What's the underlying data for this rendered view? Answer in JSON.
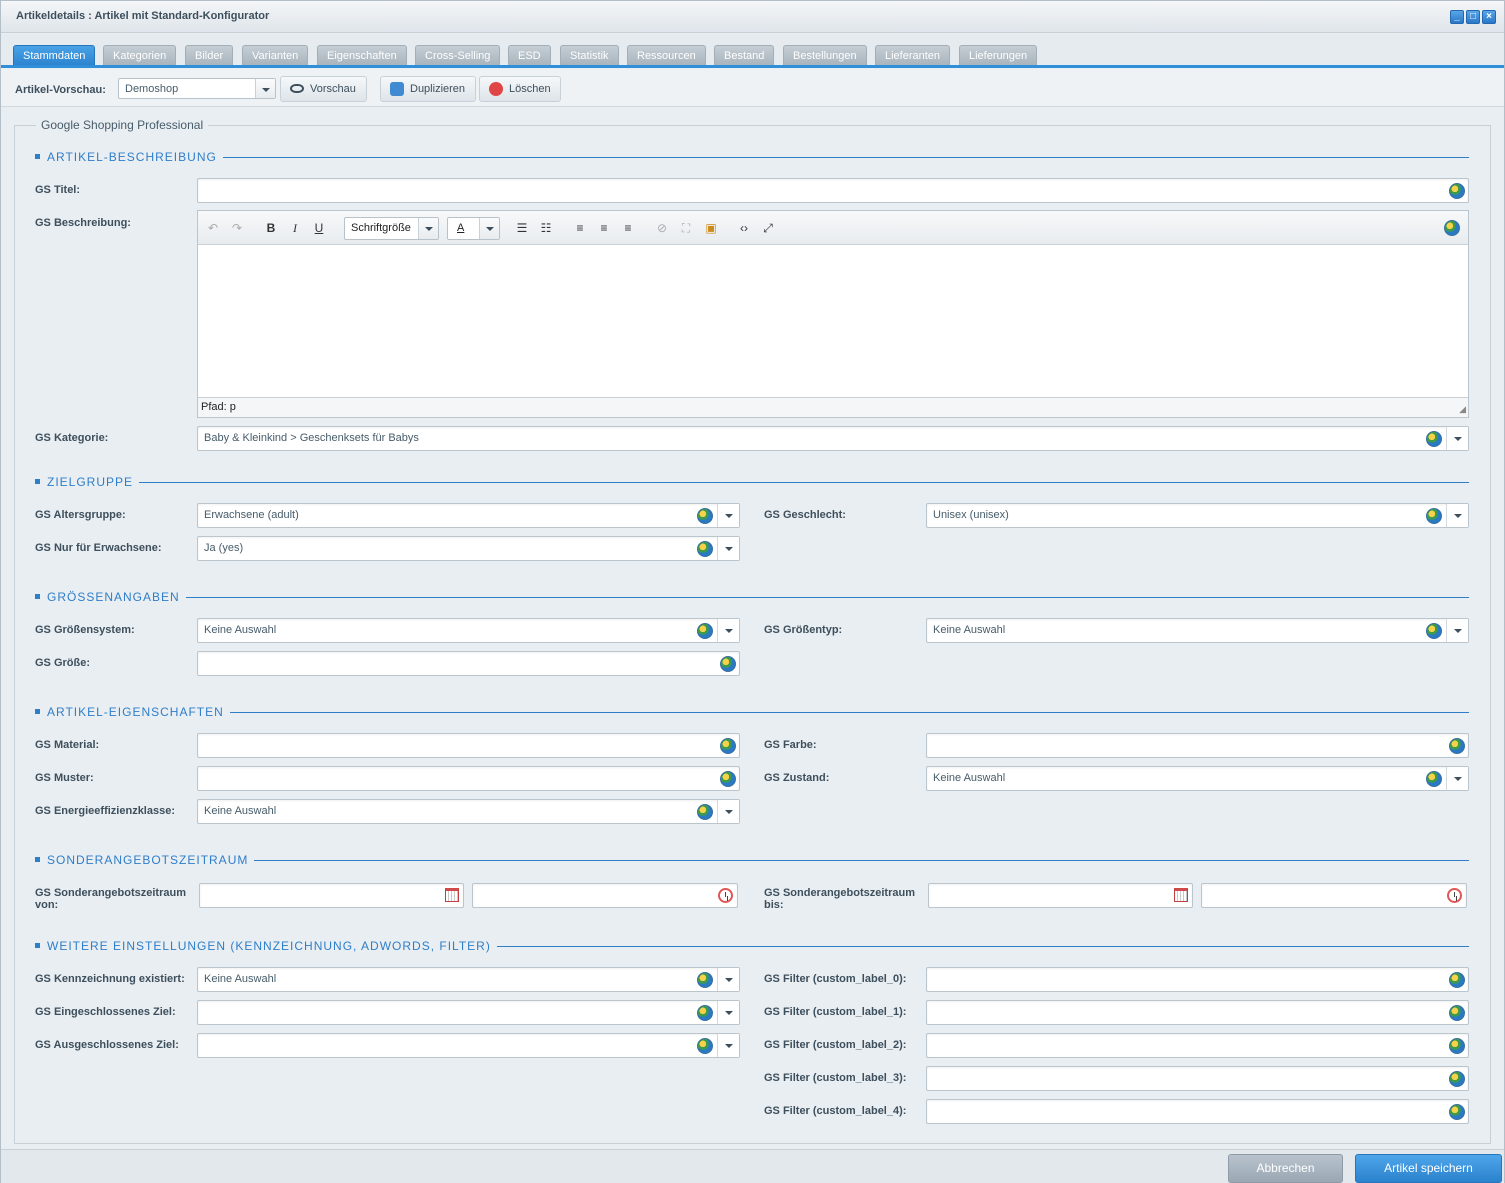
{
  "window": {
    "title": "Artikeldetails : Artikel mit Standard-Konfigurator"
  },
  "tabs": [
    "Stammdaten",
    "Kategorien",
    "Bilder",
    "Varianten",
    "Eigenschaften",
    "Cross-Selling",
    "ESD",
    "Statistik",
    "Ressourcen",
    "Bestand",
    "Bestellungen",
    "Lieferanten",
    "Lieferungen"
  ],
  "toolbar": {
    "preview_label": "Artikel-Vorschau:",
    "shop_value": "Demoshop",
    "vorschau": "Vorschau",
    "duplizieren": "Duplizieren",
    "loeschen": "Löschen"
  },
  "panel": {
    "legend": "Google Shopping Professional"
  },
  "sections": {
    "beschreibung": "ARTIKEL-BESCHREIBUNG",
    "zielgruppe": "ZIELGRUPPE",
    "groesse": "GRÖSSENANGABEN",
    "eigenschaften": "ARTIKEL-EIGENSCHAFTEN",
    "sonder": "SONDERANGEBOTSZEITRAUM",
    "weitere": "WEITERE EINSTELLUNGEN (KENNZEICHNUNG, ADWORDS, FILTER)"
  },
  "labels": {
    "titel": "GS Titel:",
    "beschreibung": "GS Beschreibung:",
    "kategorie": "GS Kategorie:",
    "altersgruppe": "GS Altersgruppe:",
    "geschlecht": "GS Geschlecht:",
    "nur_erwachsene": "GS Nur für Erwachsene:",
    "groessensystem": "GS Größensystem:",
    "groessentyp": "GS Größentyp:",
    "groesse": "GS Größe:",
    "material": "GS Material:",
    "farbe": "GS Farbe:",
    "muster": "GS Muster:",
    "zustand": "GS Zustand:",
    "energie": "GS Energieeffizienzklasse:",
    "sonder_von_1": "GS Sonderangebotszeitraum",
    "sonder_von_2": "von:",
    "sonder_bis_1": "GS Sonderangebotszeitraum",
    "sonder_bis_2": "bis:",
    "kennzeichnung": "GS Kennzeichnung existiert:",
    "eingeschlossen": "GS Eingeschlossenes Ziel:",
    "ausgeschlossen": "GS Ausgeschlossenes Ziel:",
    "filter0": "GS Filter (custom_label_0):",
    "filter1": "GS Filter (custom_label_1):",
    "filter2": "GS Filter (custom_label_2):",
    "filter3": "GS Filter (custom_label_3):",
    "filter4": "GS Filter (custom_label_4):"
  },
  "values": {
    "kategorie": "Baby & Kleinkind > Geschenksets für Babys",
    "altersgruppe": "Erwachsene (adult)",
    "geschlecht": "Unisex (unisex)",
    "nur_erwachsene": "Ja (yes)",
    "groessensystem": "Keine Auswahl",
    "groessentyp": "Keine Auswahl",
    "zustand": "Keine Auswahl",
    "energie": "Keine Auswahl",
    "kennzeichnung": "Keine Auswahl"
  },
  "editor": {
    "fontsize": "Schriftgröße",
    "path": "Pfad: p"
  },
  "footer": {
    "cancel": "Abbrechen",
    "save": "Artikel speichern"
  }
}
